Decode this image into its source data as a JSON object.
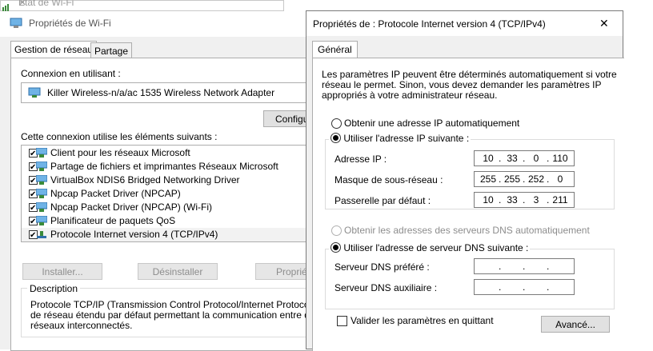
{
  "behind_window": {
    "title": "État de Wi-Fi"
  },
  "wifi_window": {
    "title": "Propriétés de Wi-Fi",
    "tabs": [
      "Gestion de réseau",
      "Partage"
    ],
    "connect_using_label": "Connexion en utilisant :",
    "adapter_name": "Killer Wireless-n/a/ac 1535 Wireless Network Adapter",
    "configure_button": "Configurer...",
    "items_label": "Cette connexion utilise les éléments suivants :",
    "items": [
      {
        "label": "Client pour les réseaux Microsoft",
        "checked": true,
        "icon": "network-client-icon"
      },
      {
        "label": "Partage de fichiers et imprimantes Réseaux Microsoft",
        "checked": true,
        "icon": "network-service-icon"
      },
      {
        "label": "VirtualBox NDIS6 Bridged Networking Driver",
        "checked": true,
        "icon": "network-service-icon"
      },
      {
        "label": "Npcap Packet Driver (NPCAP)",
        "checked": true,
        "icon": "network-service-icon"
      },
      {
        "label": "Npcap Packet Driver (NPCAP) (Wi-Fi)",
        "checked": true,
        "icon": "network-service-icon"
      },
      {
        "label": "Planificateur de paquets QoS",
        "checked": true,
        "icon": "network-service-icon"
      },
      {
        "label": "Protocole Internet version 4 (TCP/IPv4)",
        "checked": true,
        "icon": "protocol-icon"
      }
    ],
    "install_button": "Installer...",
    "uninstall_button": "Désinstaller",
    "properties_button": "Propriétés",
    "description_label": "Description",
    "description_text": [
      "Protocole TCP/IP (Transmission Control Protocol/Internet Protocol). Proto",
      "de réseau étendu par défaut permettant la communication entre différents",
      "réseaux interconnectés."
    ]
  },
  "tcp_window": {
    "title": "Propriétés de : Protocole Internet version 4 (TCP/IPv4)",
    "close_glyph": "✕",
    "tab": "Général",
    "intro": [
      "Les paramètres IP peuvent être déterminés automatiquement si votre",
      "réseau le permet. Sinon, vous devez demander les paramètres IP",
      "appropriés à votre administrateur réseau."
    ],
    "ip_auto_label": "Obtenir une adresse IP automatiquement",
    "ip_manual_label": "Utiliser l'adresse IP suivante :",
    "ip_mode": "manual",
    "ip_address_label": "Adresse IP :",
    "ip_address": [
      "10",
      "33",
      "0",
      "110"
    ],
    "subnet_label": "Masque de sous-réseau :",
    "subnet": [
      "255",
      "255",
      "252",
      "0"
    ],
    "gateway_label": "Passerelle par défaut :",
    "gateway": [
      "10",
      "33",
      "3",
      "211"
    ],
    "dns_auto_label": "Obtenir les adresses des serveurs DNS automatiquement",
    "dns_manual_label": "Utiliser l'adresse de serveur DNS suivante :",
    "dns_mode": "manual",
    "dns_preferred_label": "Serveur DNS préféré :",
    "dns_preferred": [
      "",
      "",
      "",
      ""
    ],
    "dns_alternate_label": "Serveur DNS auxiliaire :",
    "dns_alternate": [
      "",
      "",
      "",
      ""
    ],
    "validate_label": "Valider les paramètres en quittant",
    "validate_checked": false,
    "advanced_button": "Avancé..."
  }
}
